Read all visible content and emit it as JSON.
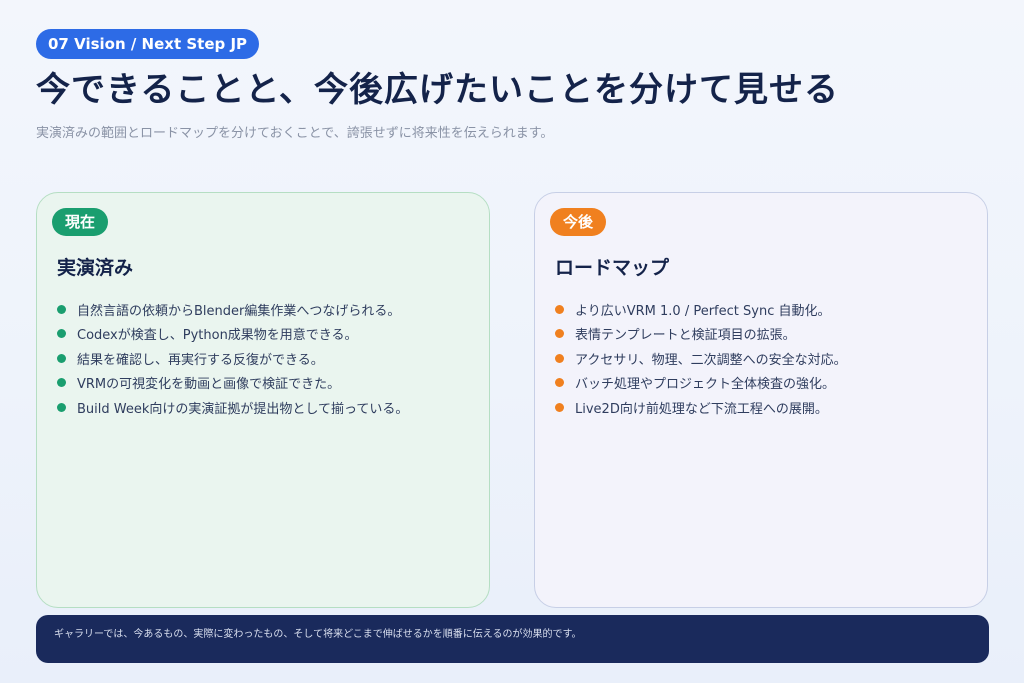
{
  "header": {
    "badge": "07  Vision / Next Step JP",
    "title": "今できることと、今後広げたいことを分けて見せる",
    "subtitle": "実演済みの範囲とロードマップを分けておくことで、誇張せずに将来性を伝えられます。"
  },
  "current": {
    "tag": "現在",
    "heading": "実演済み",
    "items": [
      "自然言語の依頼からBlender編集作業へつなげられる。",
      "Codexが検査し、Python成果物を用意できる。",
      "結果を確認し、再実行する反復ができる。",
      "VRMの可視変化を動画と画像で検証できた。",
      "Build Week向けの実演証拠が提出物として揃っている。"
    ]
  },
  "future": {
    "tag": "今後",
    "heading": "ロードマップ",
    "items": [
      "より広いVRM 1.0 / Perfect Sync 自動化。",
      "表情テンプレートと検証項目の拡張。",
      "アクセサリ、物理、二次調整への安全な対応。",
      "バッチ処理やプロジェクト全体検査の強化。",
      "Live2D向け前処理など下流工程への展開。"
    ]
  },
  "footer": {
    "text": "ギャラリーでは、今あるもの、実際に変わったもの、そして将来どこまで伸ばせるかを順番に伝えるのが効果的です。"
  },
  "colors": {
    "accent_blue": "#2d6be6",
    "current_green": "#1a9e6f",
    "future_orange": "#f0801f",
    "navy": "#1a2a5c"
  }
}
